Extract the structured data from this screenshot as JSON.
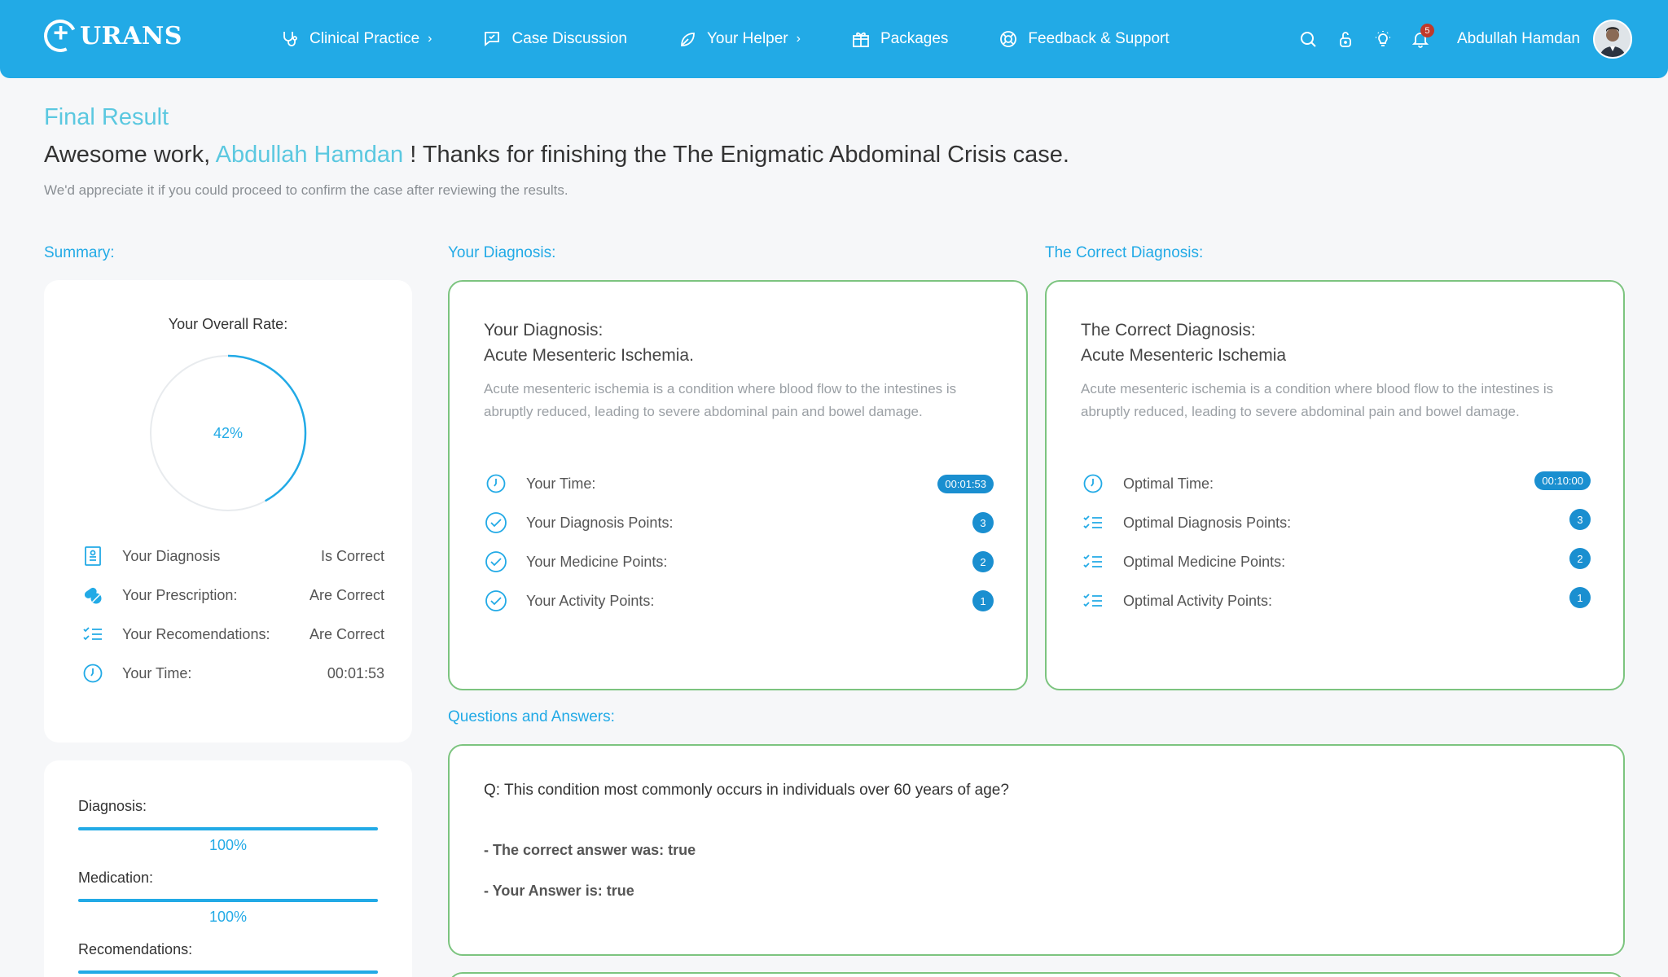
{
  "nav": {
    "logo_text": "URANS",
    "items": [
      {
        "label": "Clinical Practice",
        "chevron": "›"
      },
      {
        "label": "Case Discussion",
        "chevron": ""
      },
      {
        "label": "Your Helper",
        "chevron": "›"
      },
      {
        "label": "Packages",
        "chevron": ""
      },
      {
        "label": "Feedback & Support",
        "chevron": ""
      }
    ],
    "notification_count": "5",
    "user_name": "Abdullah Hamdan"
  },
  "header": {
    "title": "Final Result",
    "greeting_prefix": "Awesome work,",
    "greeting_name": "Abdullah Hamdan",
    "greeting_suffix": "! Thanks for finishing the The Enigmatic Abdominal Crisis case.",
    "subtext": "We'd appreciate it if you could proceed to confirm the case after reviewing the results."
  },
  "labels": {
    "summary": "Summary:",
    "your_diagnosis": "Your Diagnosis:",
    "correct_diagnosis": "The Correct Diagnosis:",
    "qa": "Questions and Answers:"
  },
  "summary": {
    "overall_label": "Your Overall Rate:",
    "overall_rate": 42,
    "overall_rate_text": "42%",
    "rows": [
      {
        "label": "Your Diagnosis",
        "value": "Is Correct",
        "icon": "clipboard-icon"
      },
      {
        "label": "Your Prescription:",
        "value": "Are Correct",
        "icon": "pills-icon"
      },
      {
        "label": "Your Recomendations:",
        "value": "Are Correct",
        "icon": "checklist-icon"
      },
      {
        "label": "Your Time:",
        "value": "00:01:53",
        "icon": "clock-icon"
      }
    ]
  },
  "progress": [
    {
      "label": "Diagnosis:",
      "value": "100%",
      "fraction": 1.0
    },
    {
      "label": "Medication:",
      "value": "100%",
      "fraction": 1.0
    },
    {
      "label": "Recomendations:",
      "value": "",
      "fraction": 1.0
    }
  ],
  "your_diagnosis": {
    "heading": "Your Diagnosis:",
    "name": "Acute Mesenteric Ischemia.",
    "description": "Acute mesenteric ischemia is a condition where blood flow to the intestines is abruptly reduced, leading to severe abdominal pain and bowel damage.",
    "rows": [
      {
        "label": "Your Time:",
        "value": "00:01:53"
      },
      {
        "label": "Your Diagnosis Points:",
        "value": "3"
      },
      {
        "label": "Your Medicine Points:",
        "value": "2"
      },
      {
        "label": "Your Activity Points:",
        "value": "1"
      }
    ]
  },
  "correct_diagnosis": {
    "heading": "The Correct Diagnosis:",
    "name": "Acute Mesenteric Ischemia",
    "description": "Acute mesenteric ischemia is a condition where blood flow to the intestines is abruptly reduced, leading to severe abdominal pain and bowel damage.",
    "rows": [
      {
        "label": "Optimal Time:",
        "value": "00:10:00"
      },
      {
        "label": "Optimal Diagnosis Points:",
        "value": "3"
      },
      {
        "label": "Optimal Medicine Points:",
        "value": "2"
      },
      {
        "label": "Optimal Activity Points:",
        "value": "1"
      }
    ]
  },
  "qa": [
    {
      "question": "Q: This condition most commonly occurs in individuals over 60 years of age?",
      "correct": "- The correct answer was: true",
      "yours": "- Your Answer is: true"
    }
  ],
  "colors": {
    "primary": "#22aae6",
    "accent_text": "#5bc8e0",
    "card_border": "#7cc47f",
    "badge": "#1a8fd0"
  }
}
